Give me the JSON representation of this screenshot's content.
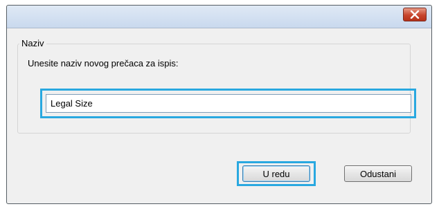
{
  "dialog": {
    "close_icon": "close-icon",
    "group_label": "Naziv",
    "instruction": "Unesite naziv novog prečaca za ispis:",
    "name_value": "Legal Size",
    "ok_label": "U redu",
    "cancel_label": "Odustani"
  },
  "colors": {
    "highlight": "#29a8e0",
    "close_button": "#c7452d",
    "dialog_background": "#f0f0f0"
  }
}
